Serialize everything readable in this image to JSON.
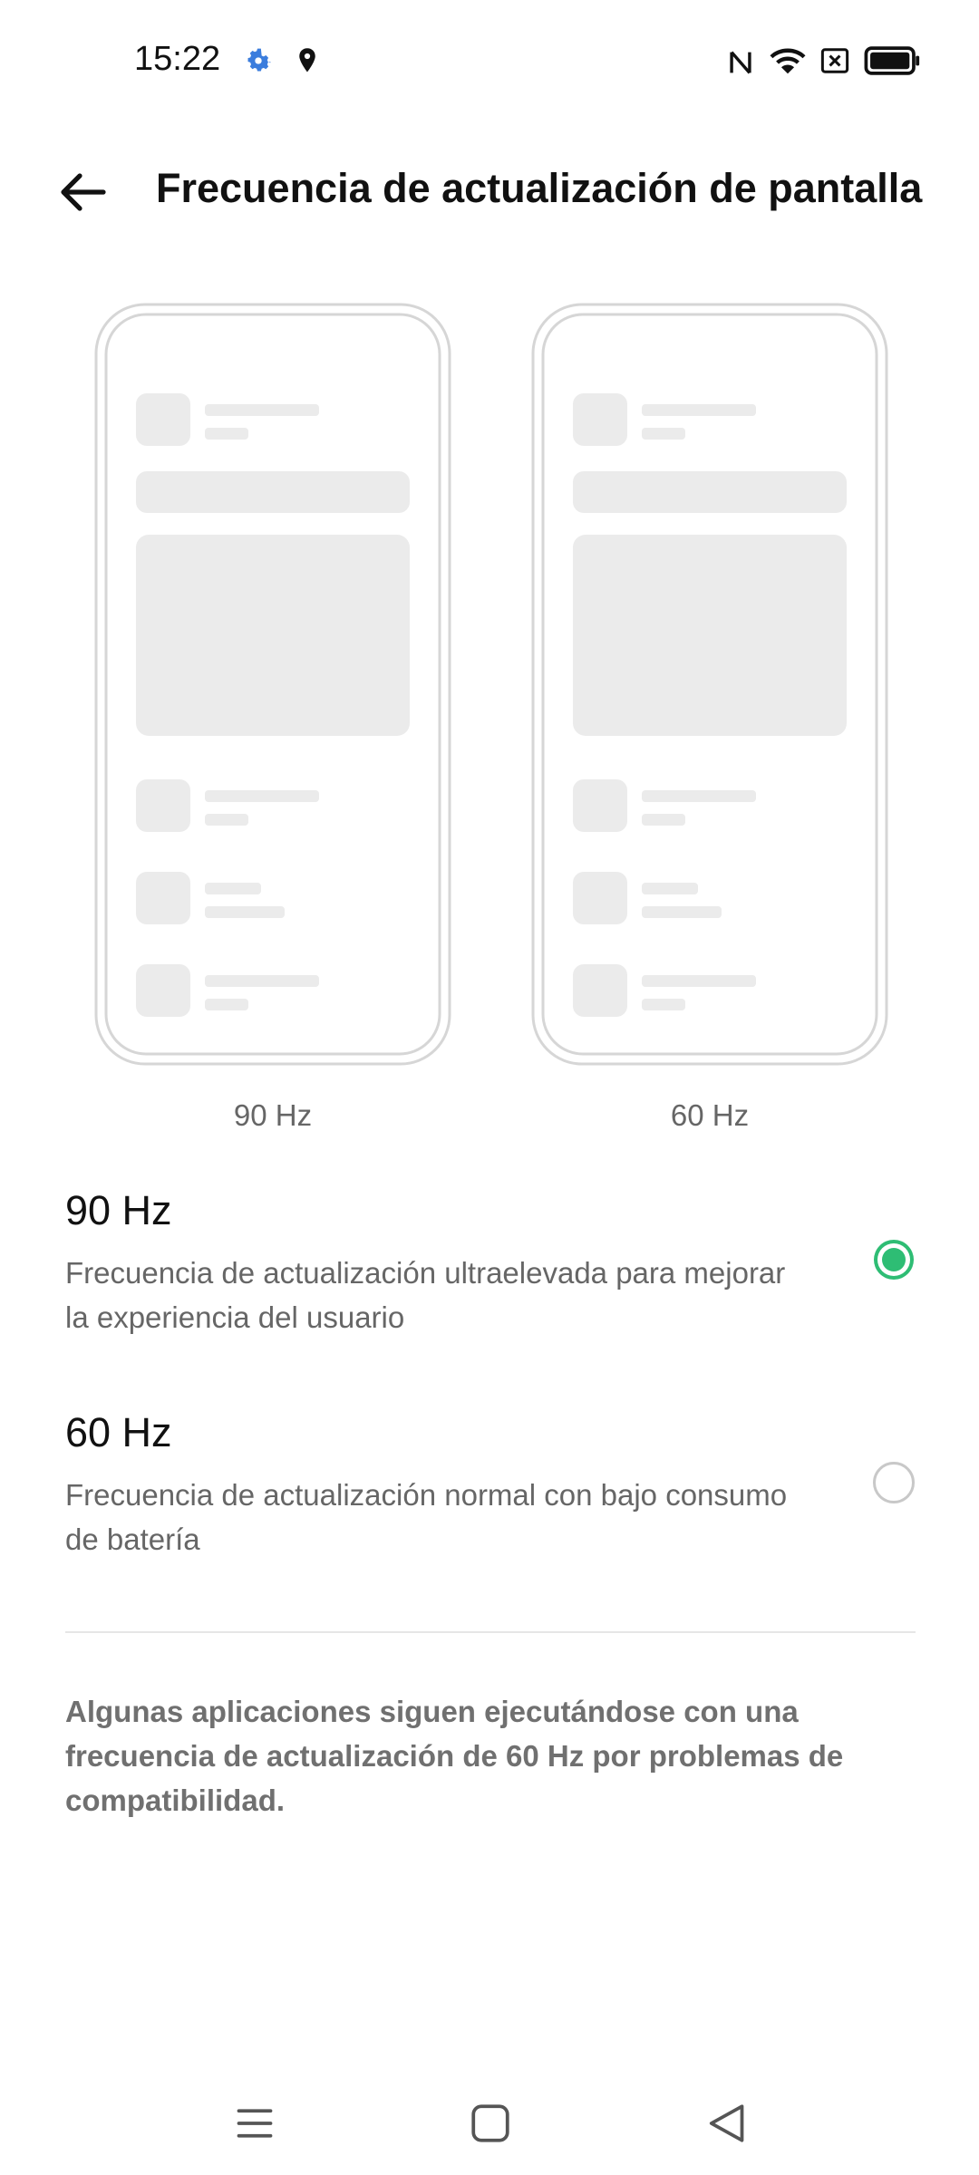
{
  "status_bar": {
    "time": "15:22",
    "icons": [
      "gear-icon",
      "location-pin-icon",
      "nfc-icon",
      "wifi-icon",
      "no-sim-icon",
      "battery-icon"
    ]
  },
  "header": {
    "title": "Frecuencia de actualización de pantalla",
    "back_icon": "arrow-left-icon"
  },
  "previews": [
    {
      "label": "90 Hz"
    },
    {
      "label": "60 Hz"
    }
  ],
  "options": [
    {
      "title": "90 Hz",
      "description": "Frecuencia de actualización ultraelevada para mejorar la experiencia del usuario",
      "selected": true
    },
    {
      "title": "60 Hz",
      "description": "Frecuencia de actualización normal con bajo consumo de batería",
      "selected": false
    }
  ],
  "note": "Algunas aplicaciones siguen ejecutándose con una frecuencia de actualización de 60 Hz por problemas de compatibilidad.",
  "colors": {
    "accent": "#2ebd74",
    "skeleton": "#ebebeb",
    "frame": "#d6d6d6"
  },
  "nav_bar": {
    "icons": [
      "menu-icon",
      "home-square-icon",
      "back-triangle-icon"
    ]
  }
}
